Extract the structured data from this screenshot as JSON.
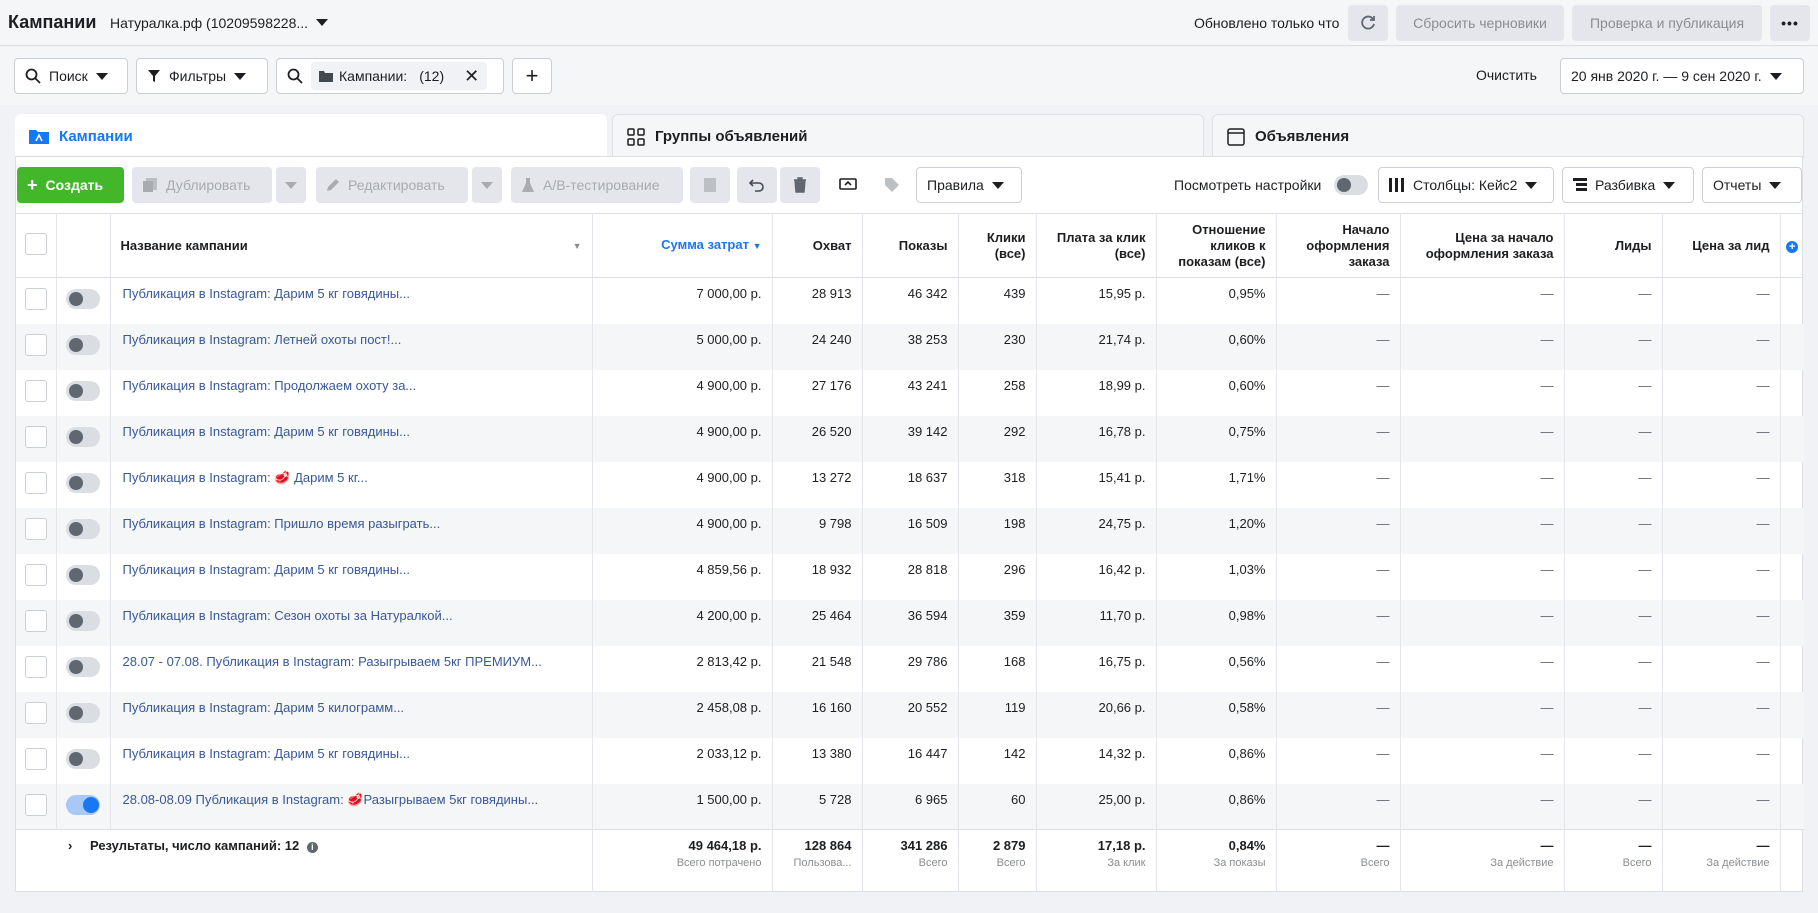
{
  "header": {
    "title": "Кампании",
    "account": "Натуралка.рф (10209598228...",
    "updated": "Обновлено только что",
    "discard_label": "Сбросить черновики",
    "publish_label": "Проверка и публикация"
  },
  "filterbar": {
    "search_label": "Поиск",
    "filters_label": "Фильтры",
    "chip_label": "Кампании:",
    "chip_count": "(12)",
    "clear_label": "Очистить",
    "date_range": "20 янв 2020 г. — 9 сен 2020 г."
  },
  "tabs": [
    {
      "label": "Кампании"
    },
    {
      "label": "Группы объявлений"
    },
    {
      "label": "Объявления"
    }
  ],
  "toolbar": {
    "create": "Создать",
    "duplicate": "Дублировать",
    "edit": "Редактировать",
    "ab_test": "A/B-тестирование",
    "rules": "Правила",
    "view_settings": "Посмотреть настройки",
    "columns": "Столбцы: Кейс2",
    "breakdown": "Разбивка",
    "reports": "Отчеты"
  },
  "columns": {
    "name": "Название кампании",
    "spend": "Сумма затрат",
    "reach": "Охват",
    "impressions": "Показы",
    "clicks": "Клики (все)",
    "cpc": "Плата за клик (все)",
    "ctr": "Отношение кликов к показам (все)",
    "checkouts": "Начало оформления заказа",
    "cost_checkout": "Цена за начало оформления заказа",
    "leads": "Лиды",
    "cost_lead": "Цена за лид"
  },
  "rows": [
    {
      "name": "Публикация в Instagram: Дарим 5 кг говядины...",
      "spend": "7 000,00 р.",
      "reach": "28 913",
      "impressions": "46 342",
      "clicks": "439",
      "cpc": "15,95 р.",
      "ctr": "0,95%",
      "on": false
    },
    {
      "name": "Публикация в Instagram: Летней охоты пост!...",
      "spend": "5 000,00 р.",
      "reach": "24 240",
      "impressions": "38 253",
      "clicks": "230",
      "cpc": "21,74 р.",
      "ctr": "0,60%",
      "on": false
    },
    {
      "name": "Публикация в Instagram: Продолжаем охоту за...",
      "spend": "4 900,00 р.",
      "reach": "27 176",
      "impressions": "43 241",
      "clicks": "258",
      "cpc": "18,99 р.",
      "ctr": "0,60%",
      "on": false
    },
    {
      "name": "Публикация в Instagram: Дарим 5 кг говядины...",
      "spend": "4 900,00 р.",
      "reach": "26 520",
      "impressions": "39 142",
      "clicks": "292",
      "cpc": "16,78 р.",
      "ctr": "0,75%",
      "on": false
    },
    {
      "name": "Публикация в Instagram: 🥩 Дарим 5 кг...",
      "spend": "4 900,00 р.",
      "reach": "13 272",
      "impressions": "18 637",
      "clicks": "318",
      "cpc": "15,41 р.",
      "ctr": "1,71%",
      "on": false
    },
    {
      "name": "Публикация в Instagram: Пришло время разыграть...",
      "spend": "4 900,00 р.",
      "reach": "9 798",
      "impressions": "16 509",
      "clicks": "198",
      "cpc": "24,75 р.",
      "ctr": "1,20%",
      "on": false
    },
    {
      "name": "Публикация в Instagram: Дарим 5 кг говядины...",
      "spend": "4 859,56 р.",
      "reach": "18 932",
      "impressions": "28 818",
      "clicks": "296",
      "cpc": "16,42 р.",
      "ctr": "1,03%",
      "on": false
    },
    {
      "name": "Публикация в Instagram: Сезон охоты за Натуралкой...",
      "spend": "4 200,00 р.",
      "reach": "25 464",
      "impressions": "36 594",
      "clicks": "359",
      "cpc": "11,70 р.",
      "ctr": "0,98%",
      "on": false
    },
    {
      "name": "28.07 - 07.08. Публикация в Instagram: Разыгрываем 5кг ПРЕМИУМ...",
      "spend": "2 813,42 р.",
      "reach": "21 548",
      "impressions": "29 786",
      "clicks": "168",
      "cpc": "16,75 р.",
      "ctr": "0,56%",
      "on": false
    },
    {
      "name": "Публикация в Instagram: Дарим 5 килограмм...",
      "spend": "2 458,08 р.",
      "reach": "16 160",
      "impressions": "20 552",
      "clicks": "119",
      "cpc": "20,66 р.",
      "ctr": "0,58%",
      "on": false
    },
    {
      "name": "Публикация в Instagram: Дарим 5 кг говядины...",
      "spend": "2 033,12 р.",
      "reach": "13 380",
      "impressions": "16 447",
      "clicks": "142",
      "cpc": "14,32 р.",
      "ctr": "0,86%",
      "on": false
    },
    {
      "name": "28.08-08.09 Публикация в Instagram: 🥩Разыгрываем 5кг говядины...",
      "spend": "1 500,00 р.",
      "reach": "5 728",
      "impressions": "6 965",
      "clicks": "60",
      "cpc": "25,00 р.",
      "ctr": "0,86%",
      "on": true
    }
  ],
  "dash": "—",
  "totals": {
    "label": "Результаты, число кампаний: 12",
    "spend": "49 464,18 р.",
    "spend_sub": "Всего потрачено",
    "reach": "128 864",
    "reach_sub": "Пользова...",
    "impressions": "341 286",
    "impressions_sub": "Всего",
    "clicks": "2 879",
    "clicks_sub": "Всего",
    "cpc": "17,18 р.",
    "cpc_sub": "За клик",
    "ctr": "0,84%",
    "ctr_sub": "За показы",
    "checkouts": "—",
    "checkouts_sub": "Всего",
    "cost_checkout": "—",
    "cost_checkout_sub": "За действие",
    "leads": "—",
    "leads_sub": "Всего",
    "cost_lead": "—",
    "cost_lead_sub": "За действие"
  }
}
